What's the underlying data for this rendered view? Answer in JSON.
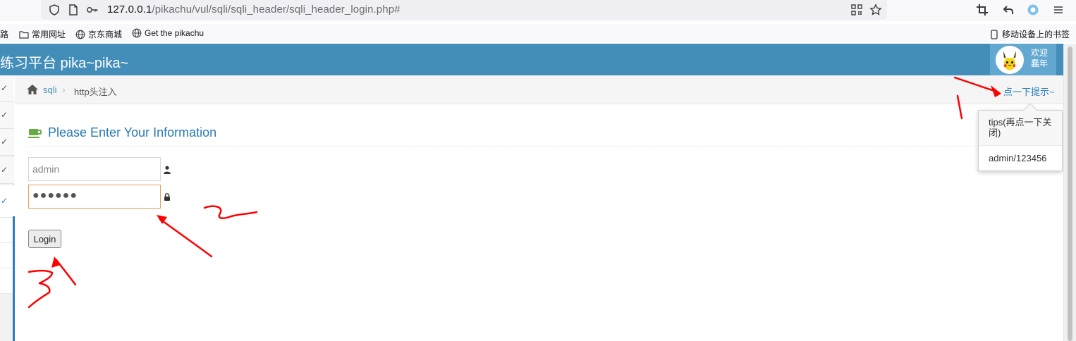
{
  "browser": {
    "url_host": "127.0.0.1",
    "url_path": "/pikachu/vul/sqli/sqli_header/sqli_header_login.php#",
    "bookmarks": [
      {
        "label": "路"
      },
      {
        "label": "常用网址"
      },
      {
        "label": "京东商城"
      },
      {
        "label": "Get the pikachu"
      }
    ],
    "mobile_bookmarks": "移动设备上的书签"
  },
  "navbar": {
    "brand": "练习平台 pika~pika~",
    "user_greeting": "欢迎",
    "user_name": "蠢年"
  },
  "sidebar": {
    "items": [
      {
        "icon": "check-icon",
        "active": false
      },
      {
        "icon": "check-icon",
        "active": false
      },
      {
        "icon": "check-icon",
        "active": false
      },
      {
        "icon": "check-icon",
        "active": true
      }
    ]
  },
  "breadcrumbs": {
    "parent": "sqli",
    "current": "http头注入",
    "hint_link": "点一下提示~"
  },
  "popover": {
    "title": "tips(再点一下关闭)",
    "body": "admin/123456"
  },
  "form": {
    "title": "Please Enter Your Information",
    "username_value": "admin",
    "password_masked": "●●●●●●",
    "login_label": "Login"
  },
  "colors": {
    "navbar": "#438eb9",
    "user_box": "#62a8d1",
    "link": "#4c8fbd",
    "title": "#2679b5",
    "annotation": "#ff0000"
  }
}
